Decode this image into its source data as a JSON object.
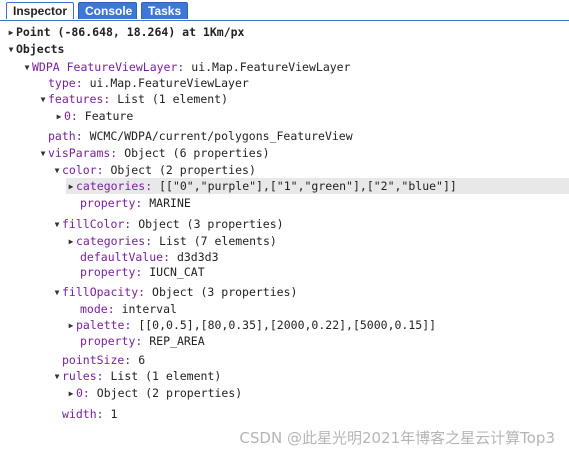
{
  "tabs": {
    "inspector": "Inspector",
    "console": "Console",
    "tasks": "Tasks"
  },
  "tree": {
    "point_header": "Point (-86.648, 18.264) at 1Km/px",
    "objects_header": "Objects",
    "layer": {
      "key": "WDPA FeatureViewLayer:",
      "value": "ui.Map.FeatureViewLayer"
    },
    "type": {
      "key": "type:",
      "value": "ui.Map.FeatureViewLayer"
    },
    "features": {
      "key": "features:",
      "value": "List (1 element)"
    },
    "feature0": {
      "key": "0:",
      "value": "Feature"
    },
    "path": {
      "key": "path:",
      "value": "WCMC/WDPA/current/polygons_FeatureView"
    },
    "visParams": {
      "key": "visParams:",
      "value": "Object (6 properties)"
    },
    "color": {
      "key": "color:",
      "value": "Object (2 properties)"
    },
    "color_categories": {
      "key": "categories:",
      "value": "[[\"0\",\"purple\"],[\"1\",\"green\"],[\"2\",\"blue\"]]"
    },
    "color_property": {
      "key": "property:",
      "value": "MARINE"
    },
    "fillColor": {
      "key": "fillColor:",
      "value": "Object (3 properties)"
    },
    "fill_categories": {
      "key": "categories:",
      "value": "List (7 elements)"
    },
    "fill_default": {
      "key": "defaultValue:",
      "value": "d3d3d3"
    },
    "fill_property": {
      "key": "property:",
      "value": "IUCN_CAT"
    },
    "fillOpacity": {
      "key": "fillOpacity:",
      "value": "Object (3 properties)"
    },
    "op_mode": {
      "key": "mode:",
      "value": "interval"
    },
    "op_palette": {
      "key": "palette:",
      "value": "[[0,0.5],[80,0.35],[2000,0.22],[5000,0.15]]"
    },
    "op_property": {
      "key": "property:",
      "value": "REP_AREA"
    },
    "pointSize": {
      "key": "pointSize:",
      "value": "6"
    },
    "rules": {
      "key": "rules:",
      "value": "List (1 element)"
    },
    "rule0": {
      "key": "0:",
      "value": "Object (2 properties)"
    },
    "width": {
      "key": "width:",
      "value": "1"
    }
  },
  "watermark": "CSDN @此星光明2021年博客之星云计算Top3",
  "icons": {
    "expanded": "triangle-down",
    "collapsed": "triangle-right"
  }
}
